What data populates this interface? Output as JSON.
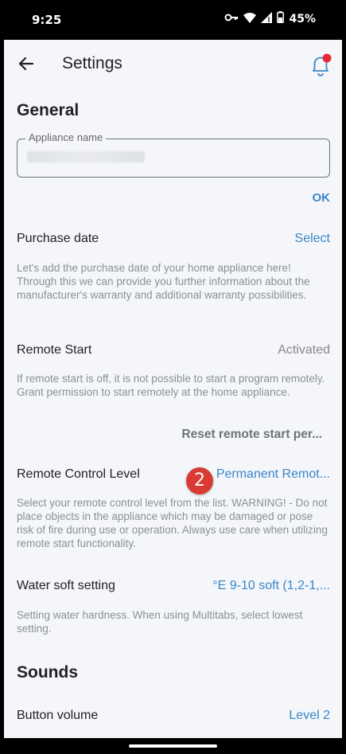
{
  "status_bar": {
    "time": "9:25",
    "battery": "45%",
    "icons": [
      "key-icon",
      "wifi-icon",
      "signal-icon",
      "battery-icon"
    ]
  },
  "appbar": {
    "title": "Settings",
    "back_icon": "arrow-left-icon",
    "notification_icon": "bell-icon",
    "notification_dot_color": "#e8283a"
  },
  "general": {
    "section_title": "General",
    "appliance_name_label": "Appliance name",
    "ok_label": "OK",
    "purchase_date": {
      "label": "Purchase date",
      "value": "Select",
      "description": "Let's add the purchase date of your home appliance here! Through this we can provide you further information about the manufacturer's warranty and additional warranty possibilities."
    },
    "remote_start": {
      "label": "Remote Start",
      "value": "Activated",
      "description": "If remote start is off, it is not possible to start a program remotely. Grant permission to start remotely at the home appliance.",
      "reset_label": "Reset remote start per..."
    },
    "remote_control_level": {
      "label": "Remote Control Level",
      "value": "Permanent Remot...",
      "description": "Select your remote control level from the list. WARNING! - Do not place objects in the appliance which may be damaged or pose risk of fire during use or operation. Always use care when utilizing remote start functionality."
    },
    "water_soft": {
      "label": "Water soft setting",
      "value": "°E 9-10 soft (1,2-1,...",
      "description": "Setting water hardness. When using Multitabs, select lowest setting."
    }
  },
  "sounds": {
    "section_title": "Sounds",
    "button_volume": {
      "label": "Button volume",
      "value": "Level 2"
    }
  },
  "step_badge": "2",
  "colors": {
    "accent": "#3a86c8",
    "background": "#f4f6fa",
    "badge": "#d93a33"
  }
}
